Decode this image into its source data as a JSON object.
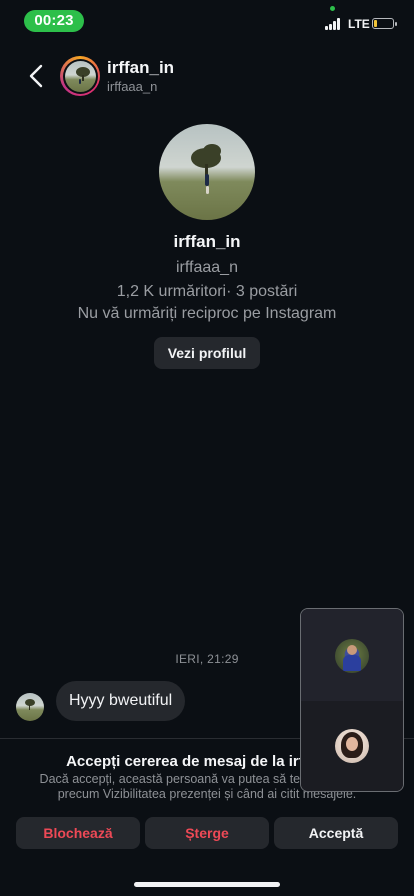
{
  "status_bar": {
    "time": "00:23",
    "network": "LTE",
    "battery_level": 0.15,
    "icons": [
      "signal-bars-icon",
      "battery-icon"
    ]
  },
  "header": {
    "back_icon": "chevron-left-icon",
    "display_name": "irffan_in",
    "username": "irffaaa_n"
  },
  "profile": {
    "display_name": "irffan_in",
    "username": "irffaaa_n",
    "stats": "1,2 K urmăritori· 3 postări",
    "mutual": "Nu vă urmăriți reciproc pe Instagram",
    "view_profile_label": "Vezi profilul"
  },
  "messages": {
    "timestamp": "IERI, 21:29",
    "items": [
      {
        "text": "Hyyy bweutiful"
      }
    ]
  },
  "request": {
    "title": "Accepți cererea de mesaj de la irffan_in",
    "description": "Dacă accepți, această persoană va putea să te s... informații precum Vizibilitatea prezenței și când ai citit mesajele.",
    "block_label": "Blochează",
    "delete_label": "Șterge",
    "accept_label": "Acceptă"
  },
  "colors": {
    "background": "#0b0f14",
    "danger": "#ed4956",
    "call_pill": "#2dbf4a",
    "button_bg": "#25282d"
  }
}
